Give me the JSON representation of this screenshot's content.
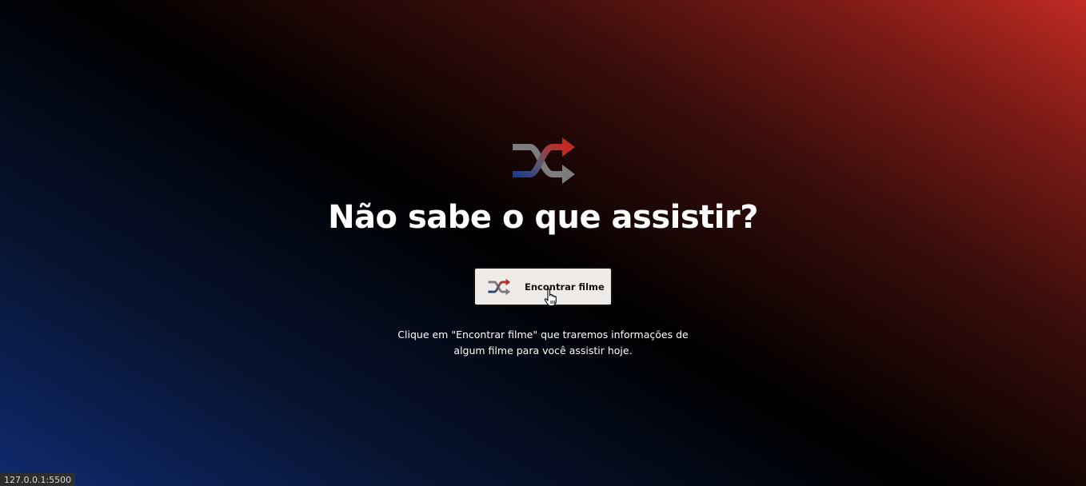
{
  "hero": {
    "icon": "shuffle-icon",
    "title": "Não sabe o que assistir?"
  },
  "action": {
    "icon": "shuffle-icon",
    "button_label": "Encontrar filme"
  },
  "description": "Clique em \"Encontrar filme\" que traremos informações de algum filme para você assistir hoje.",
  "status_bar": {
    "url": "127.0.0.1:5500"
  },
  "colors": {
    "accent_red": "#c02a24",
    "accent_blue": "#1e3a8a",
    "icon_gray": "#7d7d7d",
    "button_bg": "#efebe8",
    "text": "#ffffff"
  }
}
